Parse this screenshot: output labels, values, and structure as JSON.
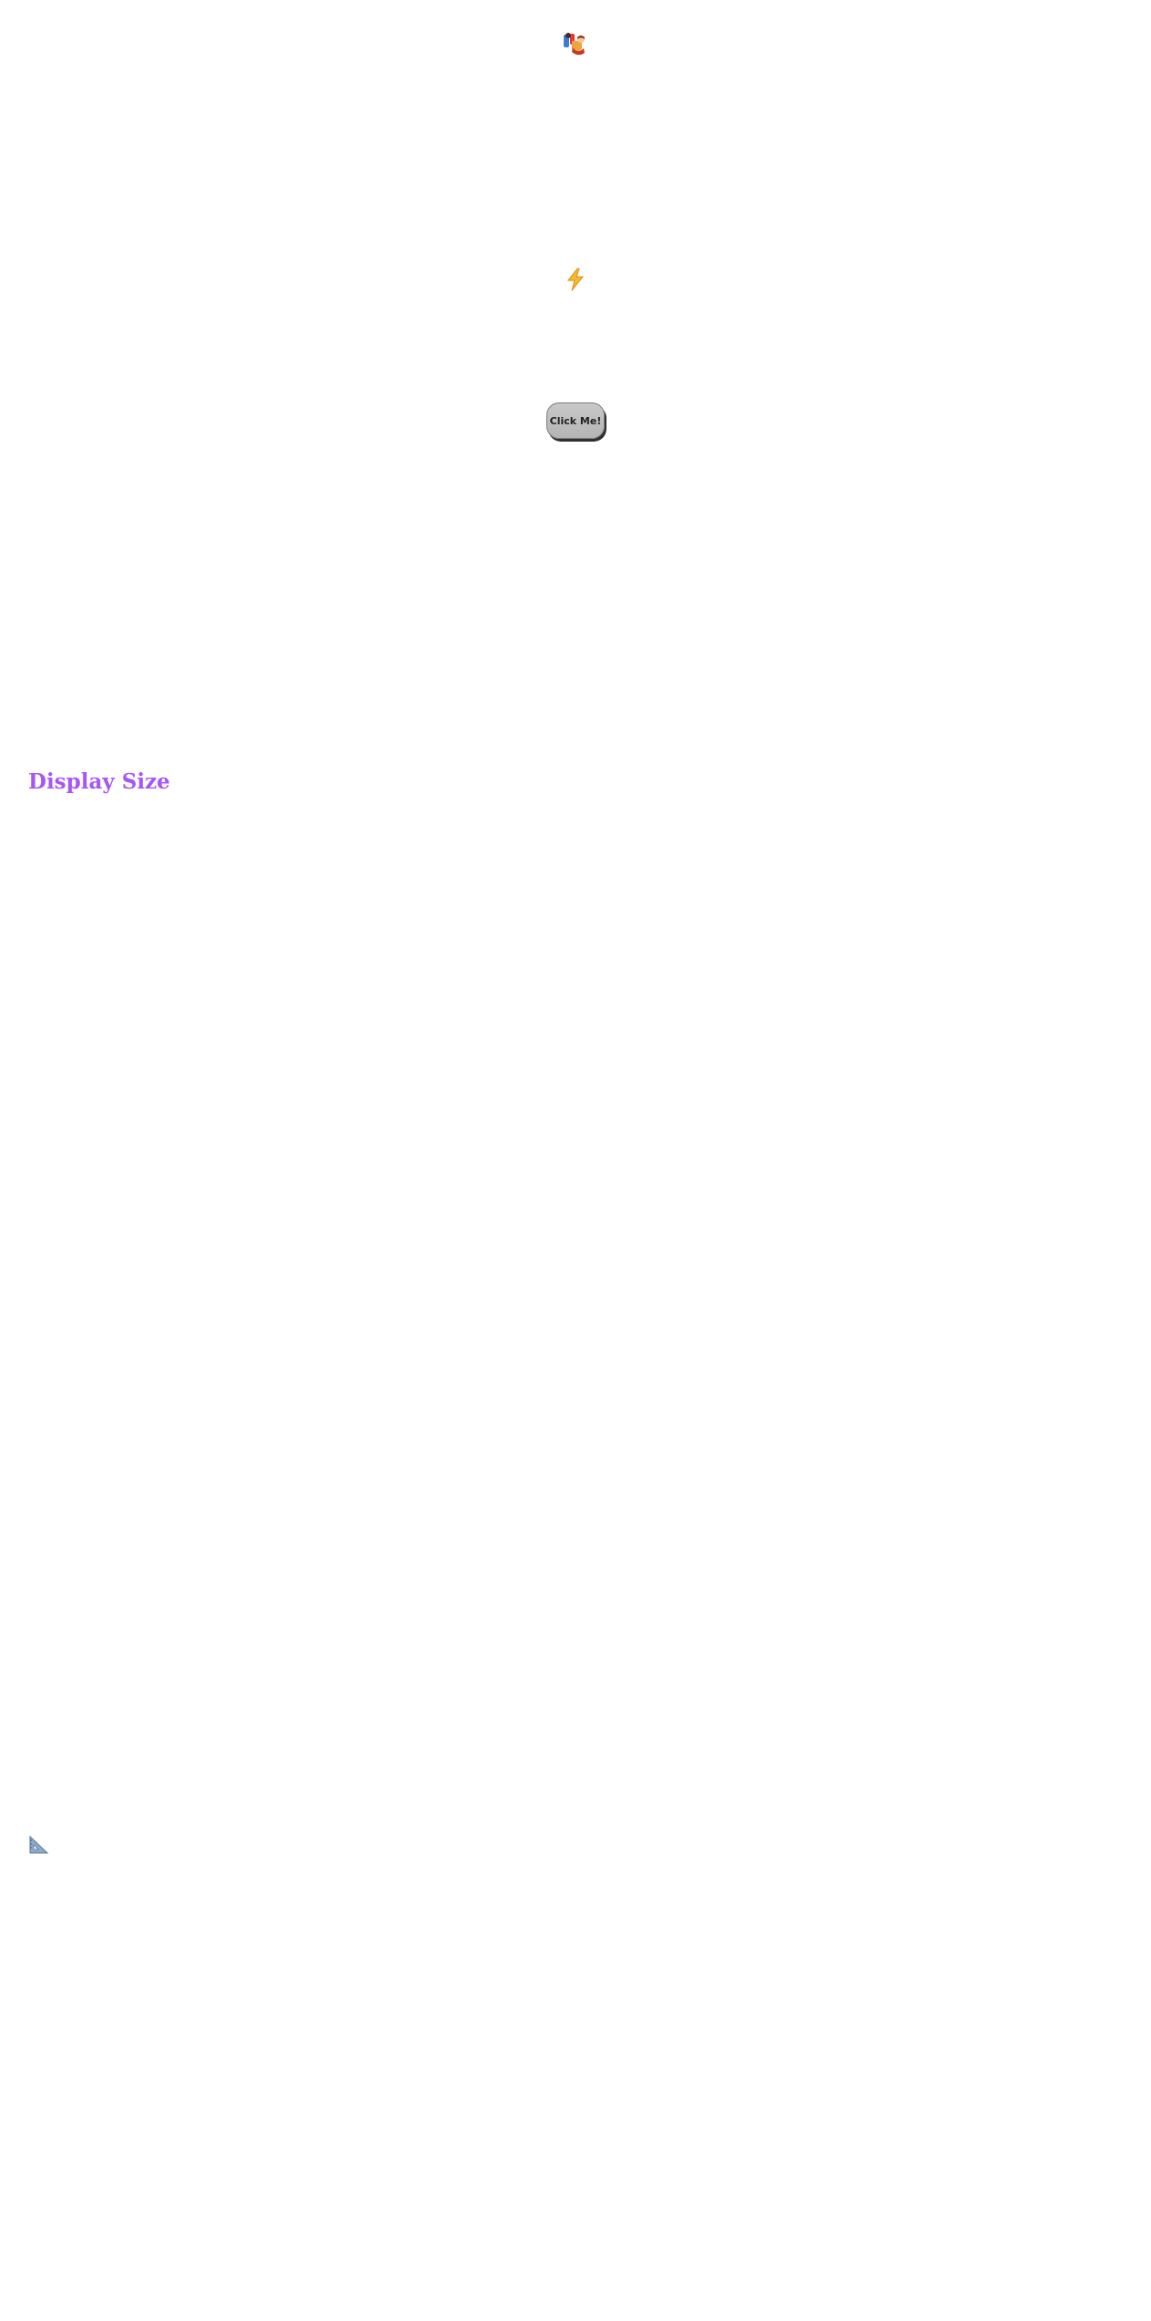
{
  "header": {
    "icon": "dancers-icon"
  },
  "feature": {
    "icon": "lightning-bolt-icon",
    "accent": "#f5b82e"
  },
  "cta": {
    "label": "Click Me!",
    "background": "#c0c0c0"
  },
  "section": {
    "title": "Display Size",
    "title_color": "#a855f7",
    "icon": "triangular-ruler-icon"
  }
}
